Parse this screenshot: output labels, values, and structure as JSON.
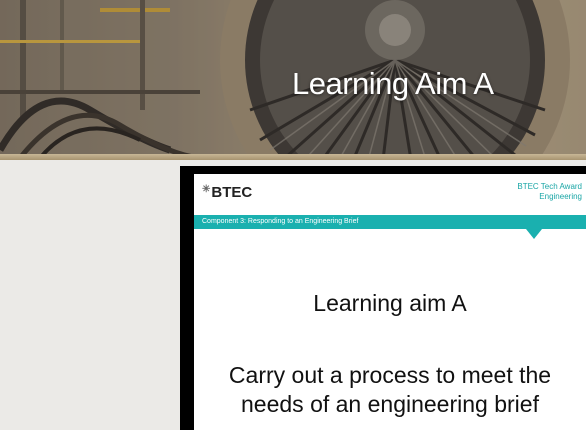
{
  "banner": {
    "title": "Learning Aim A"
  },
  "slide": {
    "logo": "BTEC",
    "award_line1": "BTEC Tech Award",
    "award_line2": "Engineering",
    "component": "Component 3: Responding to an Engineering Brief",
    "heading": "Learning aim A",
    "subtitle_line1": "Carry out a process to meet the",
    "subtitle_line2": "needs of an engineering brief",
    "accent_color": "#1ab0af"
  },
  "icons": {
    "logo_mark": "asterisk-mark-icon"
  }
}
